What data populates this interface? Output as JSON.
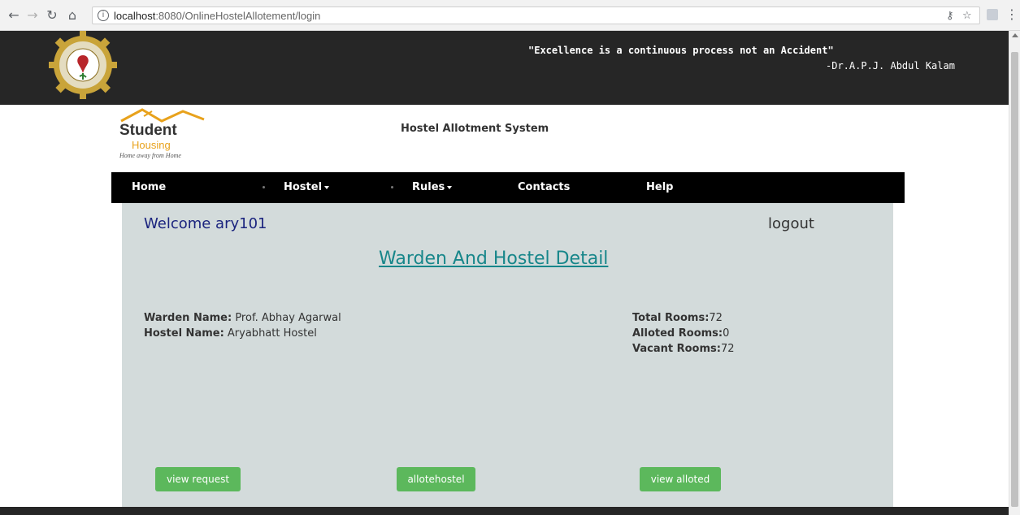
{
  "browser": {
    "url_host": "localhost",
    "url_path": ":8080/OnlineHostelAllotement/login"
  },
  "banner": {
    "quote": "\"Excellence is a continuous process not an Accident\"",
    "author": "-Dr.A.P.J. Abdul Kalam"
  },
  "logo": {
    "title": "Student",
    "subtitle": "Housing",
    "tagline": "Home away from Home"
  },
  "header": {
    "system_title": "Hostel Allotment System"
  },
  "nav": {
    "items": [
      {
        "label": "Home"
      },
      {
        "label": "Hostel"
      },
      {
        "label": "Rules"
      },
      {
        "label": "Contacts"
      },
      {
        "label": "Help"
      }
    ]
  },
  "panel": {
    "welcome": "Welcome ary101",
    "logout": "logout",
    "heading": "Warden And Hostel Detail",
    "warden_label": "Warden Name:",
    "warden_value": " Prof. Abhay Agarwal",
    "hostel_label": "Hostel Name:",
    "hostel_value": " Aryabhatt Hostel",
    "total_label": "Total Rooms:",
    "total_value": "72",
    "alloted_label": "Alloted Rooms:",
    "alloted_value": "0",
    "vacant_label": "Vacant Rooms:",
    "vacant_value": "72",
    "buttons": {
      "view_request": "view request",
      "allotehostel": "allotehostel",
      "view_alloted": "view alloted"
    }
  },
  "colors": {
    "banner": "#262626",
    "panel": "#d3dbdb",
    "button": "#5cb85c",
    "heading": "#17868a"
  }
}
